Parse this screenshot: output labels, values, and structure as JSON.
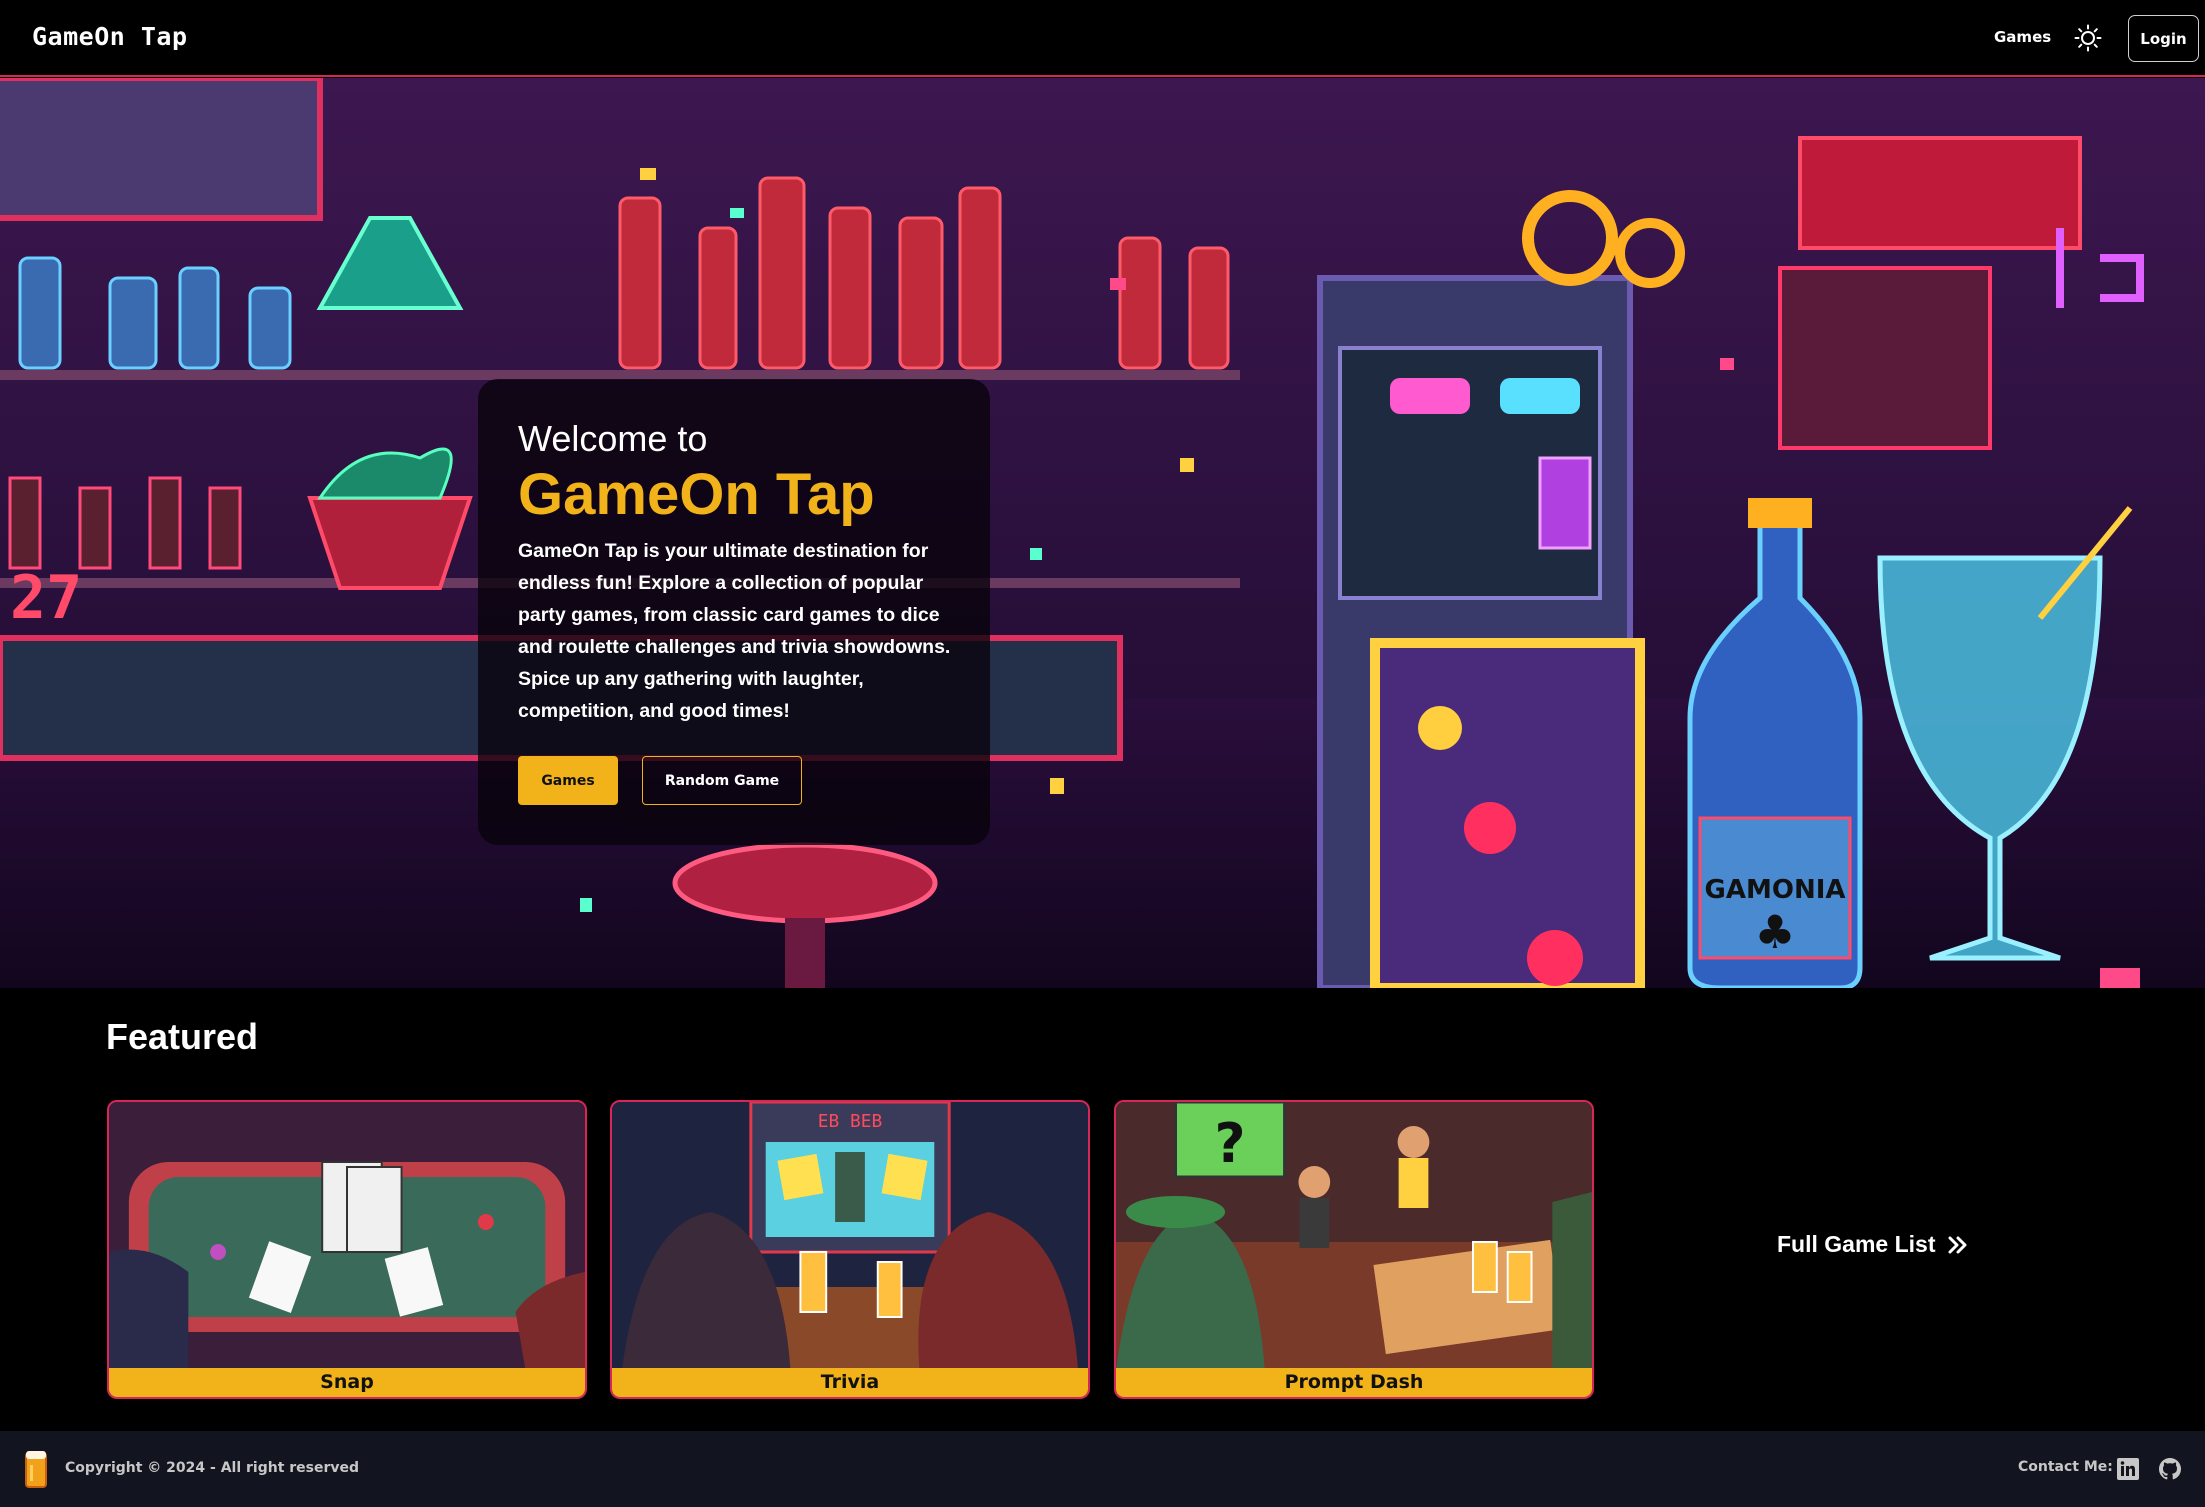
{
  "header": {
    "brand": "GameOn Tap",
    "nav_games": "Games",
    "theme_icon": "sun-icon",
    "login_label": "Login"
  },
  "hero": {
    "welcome_pre": "Welcome to",
    "title": "GameOn Tap",
    "description": "GameOn Tap is your ultimate destination for endless fun! Explore a collection of popular party games, from classic card games to dice and roulette challenges and trivia showdowns. Spice up any gathering with laughter, competition, and good times!",
    "games_button": "Games",
    "random_button": "Random Game"
  },
  "featured": {
    "title": "Featured",
    "cards": [
      {
        "label": "Snap"
      },
      {
        "label": "Trivia"
      },
      {
        "label": "Prompt Dash"
      }
    ],
    "full_list_label": "Full Game List",
    "full_list_icon": "double-chevron-right-icon"
  },
  "footer": {
    "copyright": "Copyright © 2024 - All right reserved",
    "contact_label": "Contact Me:",
    "icons": [
      "linkedin-icon",
      "github-icon"
    ]
  },
  "colors": {
    "accent_yellow": "#f2b21a",
    "accent_pink": "#d8265a",
    "footer_bg": "#12151f"
  }
}
